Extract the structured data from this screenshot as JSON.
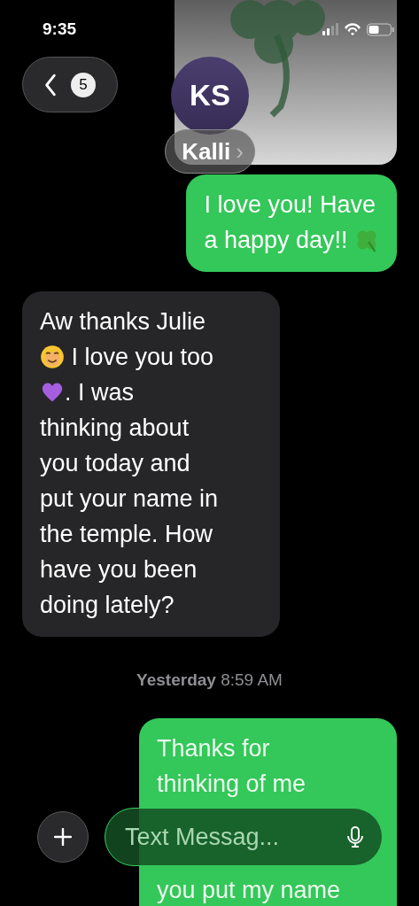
{
  "status_bar": {
    "time": "9:35"
  },
  "header": {
    "back_badge": "5",
    "avatar_initials": "KS",
    "contact_name": "Kalli",
    "chevron": "›"
  },
  "messages": [
    {
      "kind": "picture",
      "outgoing": true
    },
    {
      "kind": "bubble",
      "outgoing": true,
      "lines": [
        [
          {
            "kind": "text",
            "text": "I love you! Have"
          }
        ],
        [
          {
            "kind": "text",
            "text": "a happy day!! "
          },
          {
            "kind": "clover"
          }
        ]
      ]
    },
    {
      "kind": "bubble",
      "outgoing": false,
      "lines": [
        [
          {
            "kind": "text",
            "text": "Aw thanks Julie"
          }
        ],
        [
          {
            "kind": "smile"
          },
          {
            "kind": "text",
            "text": " I love you too"
          }
        ],
        [
          {
            "kind": "heart"
          },
          {
            "kind": "text",
            "text": ". I was"
          }
        ],
        [
          {
            "kind": "text",
            "text": "thinking about"
          }
        ],
        [
          {
            "kind": "text",
            "text": "you today and"
          }
        ],
        [
          {
            "kind": "text",
            "text": "put your name in"
          }
        ],
        [
          {
            "kind": "text",
            "text": "the temple. How"
          }
        ],
        [
          {
            "kind": "text",
            "text": "have you been"
          }
        ],
        [
          {
            "kind": "text",
            "text": "doing lately?"
          }
        ]
      ]
    },
    {
      "kind": "timestamp",
      "day": "Yesterday",
      "time": "8:59 AM"
    },
    {
      "kind": "bubble",
      "outgoing": true,
      "lines": [
        [
          {
            "kind": "text",
            "text": "Thanks for"
          }
        ],
        [
          {
            "kind": "text",
            "text": "thinking of me"
          }
        ],
        [
          {
            "kind": "covered"
          }
        ],
        [
          {
            "kind": "covered"
          }
        ],
        [
          {
            "kind": "text",
            "text": "you put my name"
          }
        ]
      ]
    }
  ],
  "composer": {
    "placeholder": "Text Messag..."
  }
}
